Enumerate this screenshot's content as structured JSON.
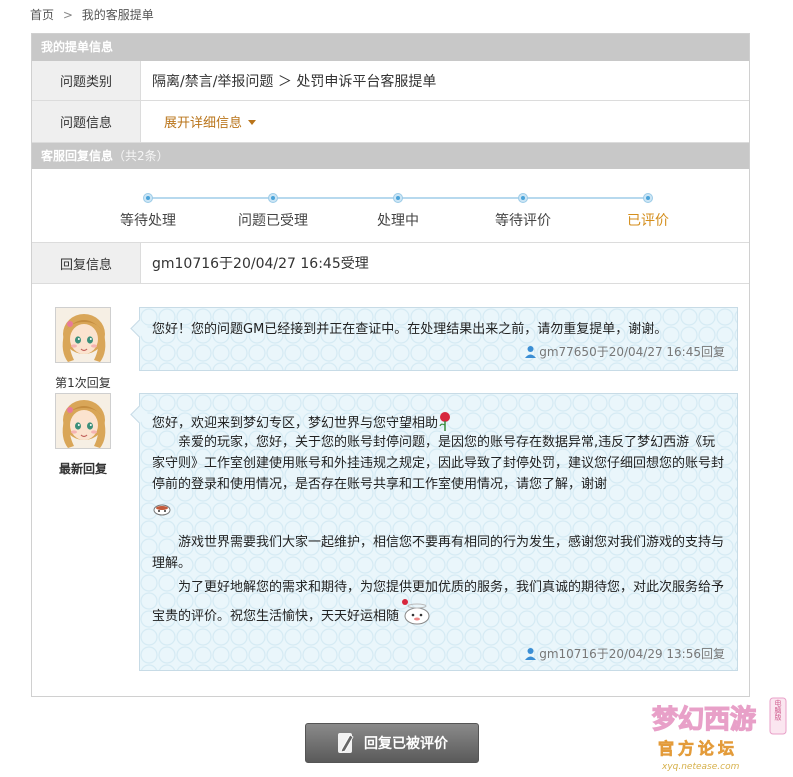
{
  "breadcrumb": {
    "home": "首页",
    "current": "我的客服提单"
  },
  "ticket_info": {
    "header": "我的提单信息",
    "category_label": "问题类别",
    "category_value": "隔离/禁言/举报问题 ＞ 处罚申诉平台客服提单",
    "info_label": "问题信息",
    "expand_text": "展开详细信息"
  },
  "reply_info": {
    "header": "客服回复信息",
    "count": "（共2条）",
    "steps": [
      "等待处理",
      "问题已受理",
      "处理中",
      "等待评价",
      "已评价"
    ],
    "current_step": 4,
    "reply_label": "回复信息",
    "reply_value": "gm10716于20/04/27 16:45受理"
  },
  "replies": [
    {
      "avatar_label": "第1次回复",
      "text": "您好！您的问题GM已经接到并正在查证中。在处理结果出来之前，请勿重复提单，谢谢。",
      "signature": "gm77650于20/04/27 16:45回复"
    },
    {
      "avatar_label": "最新回复",
      "para1": "您好，欢迎来到梦幻专区，梦幻世界与您守望相助",
      "para2": "　　亲爱的玩家，您好，关于您的账号封停问题，是因您的账号存在数据异常,违反了梦幻西游《玩家守则》工作室创建使用账号和外挂违规之规定，因此导致了封停处罚，建议您仔细回想您的账号封停前的登录和使用情况，是否存在账号共享和工作室使用情况，请您了解，谢谢",
      "para3": "　　游戏世界需要我们大家一起维护，相信您不要再有相同的行为发生，感谢您对我们游戏的支持与理解。",
      "para4": "　　为了更好地解您的需求和期待，为您提供更加优质的服务，我们真诚的期待您，对此次服务给予宝贵的评价。祝您生活愉快，天天好运相随",
      "signature": "gm10716于20/04/29 13:56回复"
    }
  ],
  "bottom_button": "回复已被评价",
  "watermark": {
    "logo_text": "梦幻西游",
    "edition": "电脑版",
    "slogan": "官方论坛",
    "url": "xyq.netease.com"
  },
  "colors": {
    "header_gray": "#c8c8c8",
    "accent_orange": "#d48e1c",
    "bubble_bg": "#eaf6fb",
    "step_blue": "#4aa3d9"
  }
}
